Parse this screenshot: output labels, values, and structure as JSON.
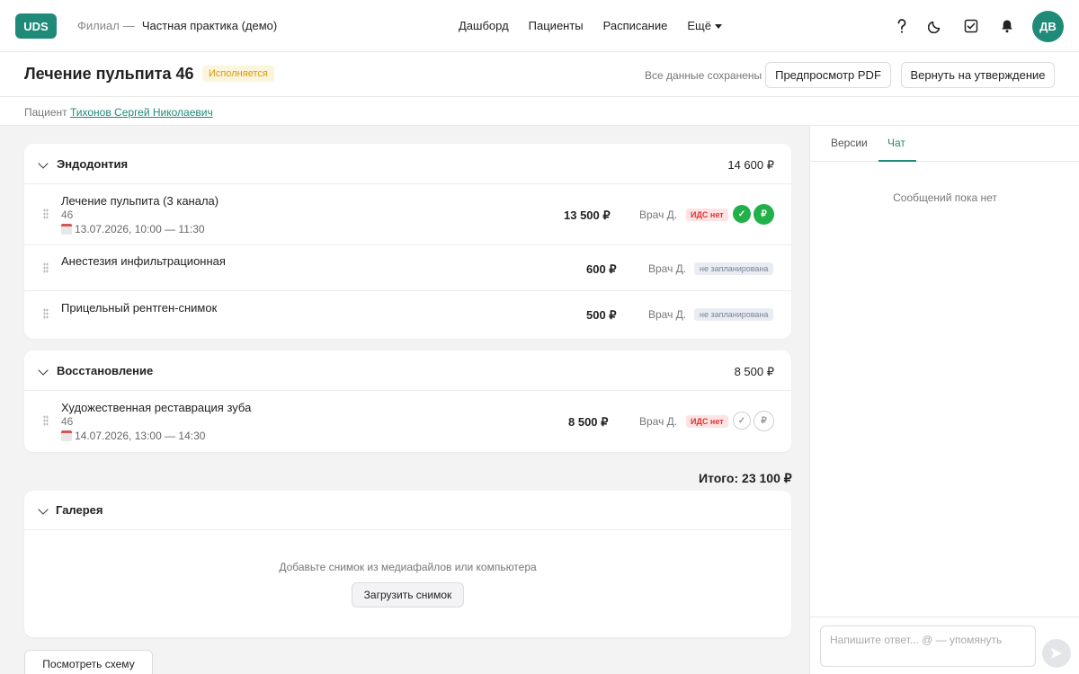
{
  "nav": {
    "logo": "UDS",
    "branch_label": "Филиал",
    "branch_dash": "—",
    "practice": "Частная практика (демо)",
    "links": [
      "Дашборд",
      "Пациенты",
      "Расписание",
      "Ещё"
    ],
    "icons": [
      "help-icon",
      "moon-icon",
      "tasks-icon",
      "bell-icon"
    ],
    "avatar": "ДВ"
  },
  "header": {
    "title": "Лечение пульпита 46",
    "status": "Исполняется",
    "saved": "Все данные сохранены",
    "preview_btn": "Предпросмотр PDF",
    "return_btn": "Вернуть на утверждение"
  },
  "patient": {
    "label": "Пациент",
    "name": "Тихонов Сергей Николаевич"
  },
  "sections": [
    {
      "title": "Эндодонтия",
      "sum": "14 600 ₽",
      "items": [
        {
          "name": "Лечение пульпита (3 канала)",
          "tooth": "46",
          "date": "13.07.2026, 10:00 — 11:30",
          "price": "13 500 ₽",
          "doctor": "Врач Д.",
          "tag": "ИДС нет",
          "done": "✓",
          "paid": "₽"
        },
        {
          "name": "Анестезия инфильтрационная",
          "price": "600 ₽",
          "doctor": "Врач Д.",
          "tag": "не запланирована"
        },
        {
          "name": "Прицельный рентген-снимок",
          "price": "500 ₽",
          "doctor": "Врач Д.",
          "tag": "не запланирована"
        }
      ]
    },
    {
      "title": "Восстановление",
      "sum": "8 500 ₽",
      "items": [
        {
          "name": "Художественная реставрация зуба",
          "tooth": "46",
          "date": "14.07.2026, 13:00 — 14:30",
          "price": "8 500 ₽",
          "doctor": "Врач Д.",
          "tag": "ИДС нет",
          "done": "✓",
          "paid": "₽"
        }
      ]
    }
  ],
  "total": "Итого: 23 100 ₽",
  "gallery": {
    "title": "Галерея",
    "hint": "Добавьте снимок из медиафайлов или компьютера",
    "upload_btn": "Загрузить снимок"
  },
  "schema_btn": "Посмотреть схему",
  "panel": {
    "tabs": [
      "Версии",
      "Чат"
    ],
    "active_tab": "Чат",
    "empty": "Сообщений пока нет",
    "reply_placeholder": "Напишите ответ... @ — упомянуть",
    "send_icon": "send-icon"
  },
  "colors": {
    "accent": "#1f8a78",
    "status": "#d39a10",
    "danger": "#d33333",
    "success": "#22b04b"
  }
}
